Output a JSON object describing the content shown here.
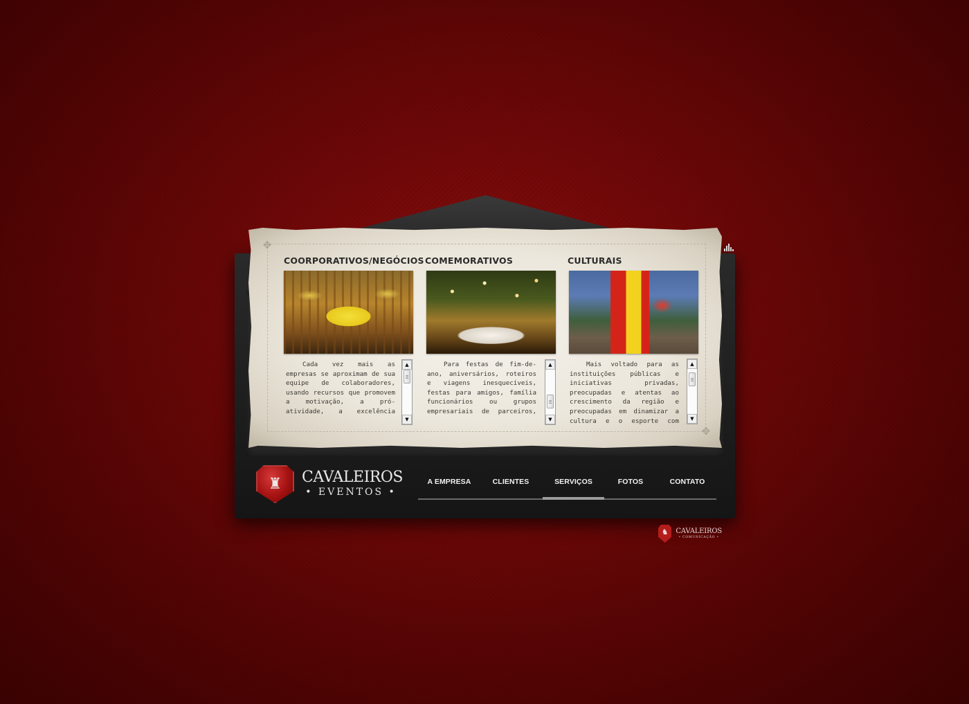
{
  "sections": [
    {
      "title": "COORPORATIVOS/NEGÓCIOS",
      "photo_icon": "banquet-hall-photo",
      "text": "Cada vez mais as empresas se aproximam de sua equipe de colaboradores, usando recursos que promovem a motivação, a pró-atividade, a excelência profissional, as exigências de",
      "scroll_fraction": 0.0
    },
    {
      "title": "COMEMORATIVOS",
      "photo_icon": "garden-party-photo",
      "text": "Para festas de fim-de-ano, aniversários, roteiros e viagens inesquecíveis, festas para amigos, família funcionários ou grupos empresariais de parceiros, fornecedores, reuniões e jantares",
      "scroll_fraction": 0.8
    },
    {
      "title": "CULTURAIS",
      "photo_icon": "jester-performance-photo",
      "text": "Mais voltado para as instituições públicas e iniciativas privadas, preocupadas e atentas ao crescimento da região e preocupadas em dinamizar a cultura e o esporte com atividades lúdicas, festivais, congressos e",
      "scroll_fraction": 0.1
    }
  ],
  "logo": {
    "main": "CAVALEIROS",
    "sub": "• EVENTOS •",
    "icon": "castle-shield-icon"
  },
  "nav": {
    "items": [
      "A EMPRESA",
      "CLIENTES",
      "SERVIÇOS",
      "FOTOS",
      "CONTATO"
    ],
    "active": "SERVIÇOS"
  },
  "credit": {
    "main": "CAVALEIROS",
    "sub": "• COMUNICAÇÃO •",
    "icon": "knight-shield-icon"
  },
  "colors": {
    "background": "#6d0707",
    "frame": "#1d1d1d",
    "paper": "#ece7dc",
    "logo_red": "#a51212"
  }
}
